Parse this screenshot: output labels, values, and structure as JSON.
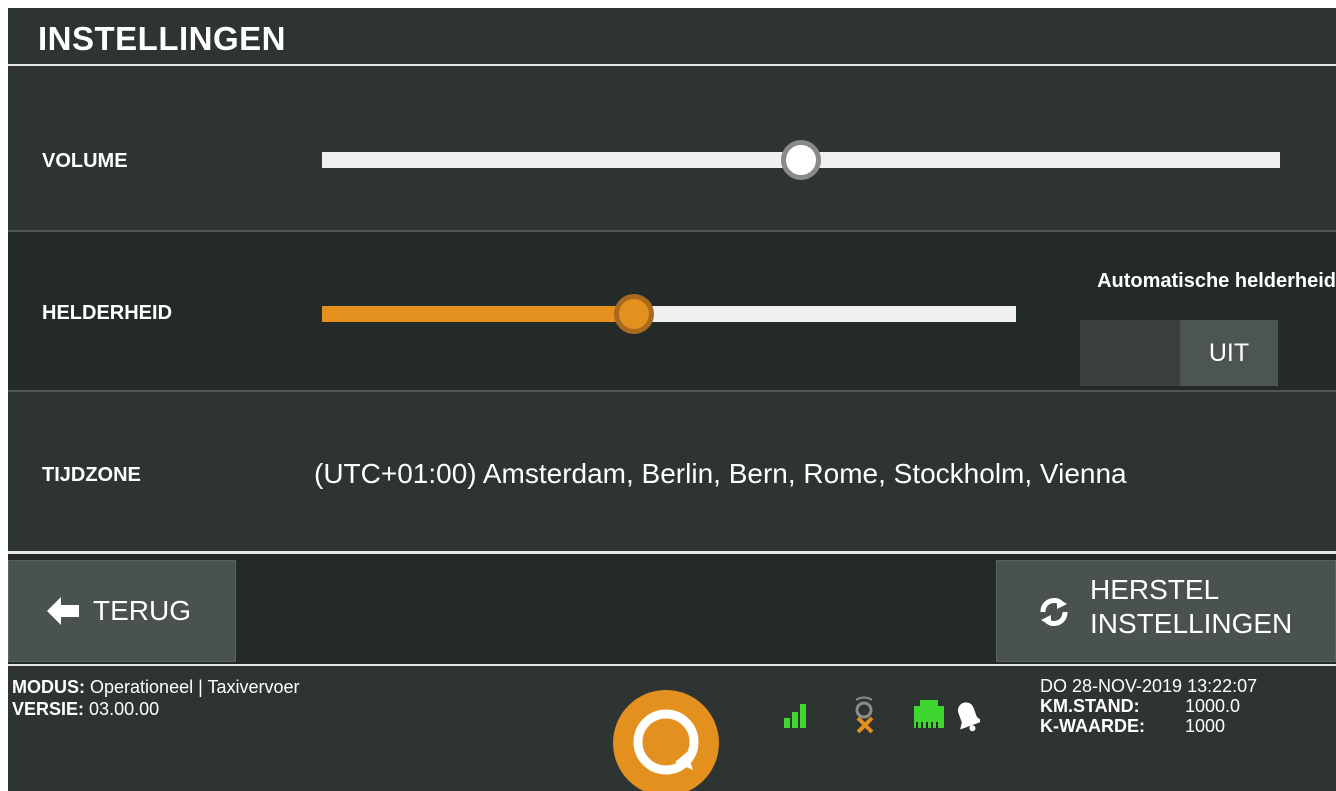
{
  "header": {
    "title": "INSTELLINGEN"
  },
  "volume": {
    "label": "VOLUME",
    "level_percent": 50
  },
  "brightness": {
    "label": "HELDERHEID",
    "level_percent": 45,
    "auto_label": "Automatische helderheid",
    "auto_state": "UIT"
  },
  "timezone": {
    "label": "TIJDZONE",
    "value": "(UTC+01:00) Amsterdam, Berlin, Bern, Rome, Stockholm, Vienna"
  },
  "buttons": {
    "back": "TERUG",
    "reset_line1": "HERSTEL",
    "reset_line2": "INSTELLINGEN"
  },
  "status": {
    "mode_label": "MODUS:",
    "mode_value": "Operationeel | Taxivervoer",
    "version_label": "VERSIE:",
    "version_value": "03.00.00",
    "datetime": "DO 28-NOV-2019 13:22:07",
    "km_label": "KM.STAND:",
    "km_value": "1000.0",
    "k_label": "K-WAARDE:",
    "k_value": "1000"
  },
  "icons": [
    "signal-bars-icon",
    "gps-error-icon",
    "network-icon",
    "bell-icon",
    "refresh-icon",
    "arrow-left-icon",
    "q-logo"
  ],
  "colors": {
    "accent": "#e3901f",
    "background": "#2e3432",
    "bar": "#232a27",
    "signal": "#3fd62f"
  }
}
